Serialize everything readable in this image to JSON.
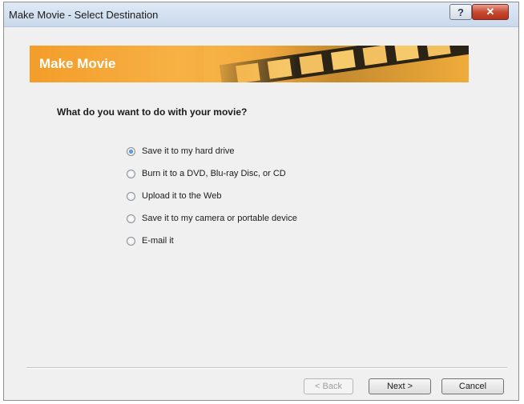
{
  "window": {
    "title": "Make Movie - Select Destination",
    "help_label": "?",
    "close_label": "✕"
  },
  "banner": {
    "title": "Make Movie"
  },
  "content": {
    "question": "What do you want to do with your movie?",
    "options": [
      {
        "label": "Save it to my hard drive",
        "selected": true
      },
      {
        "label": "Burn it to a DVD, Blu-ray Disc, or CD",
        "selected": false
      },
      {
        "label": "Upload it to the Web",
        "selected": false
      },
      {
        "label": "Save it to my camera or portable device",
        "selected": false
      },
      {
        "label": "E-mail it",
        "selected": false
      }
    ]
  },
  "footer": {
    "back_label": "< Back",
    "back_enabled": false,
    "next_label": "Next >",
    "cancel_label": "Cancel"
  },
  "colors": {
    "banner_orange": "#f39d2a",
    "radio_selected": "#1d5fb8"
  }
}
